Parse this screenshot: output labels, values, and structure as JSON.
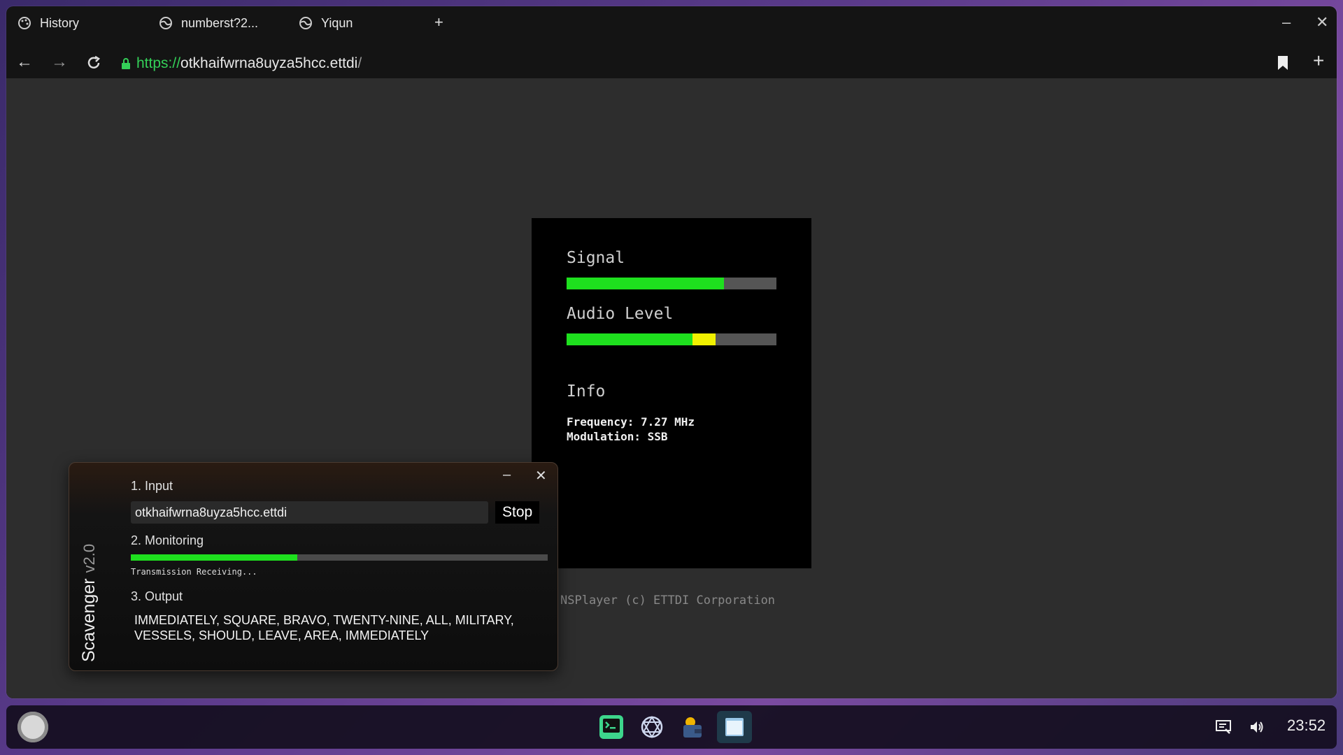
{
  "tabs": [
    {
      "label": "History",
      "icon": "palette-icon"
    },
    {
      "label": "numberst?2...",
      "icon": "globe-icon"
    },
    {
      "label": "Yiqun",
      "icon": "globe-icon"
    }
  ],
  "tab_add": "+",
  "window_controls": {
    "minimize": "–",
    "close": "✕"
  },
  "address": {
    "scheme": "https://",
    "host": "otkhaifwrna8uyza5hcc.ettdi",
    "path": "/"
  },
  "player": {
    "signal_label": "Signal",
    "signal_level": 0.75,
    "audio_label": "Audio Level",
    "audio_green_level": 0.6,
    "audio_yellow_level": 0.71,
    "info_label": "Info",
    "frequency": "Frequency: 7.27 MHz",
    "modulation": "Modulation: SSB",
    "colors": {
      "green": "#1ee01e",
      "yellow": "#f0f000"
    }
  },
  "footer": "NSPlayer (c) ETTDI Corporation",
  "scavenger": {
    "title": "Scavenger",
    "version": "v2.0",
    "input_label": "1. Input",
    "input_value": "otkhaifwrna8uyza5hcc.ettdi",
    "stop_label": "Stop",
    "monitoring_label": "2. Monitoring",
    "monitoring_progress": 0.4,
    "monitoring_status": "Transmission Receiving...",
    "output_label": "3. Output",
    "output_text": "IMMEDIATELY, SQUARE, BRAVO, TWENTY-NINE, ALL, MILITARY, VESSELS, SHOULD, LEAVE, AREA, IMMEDIATELY"
  },
  "taskbar": {
    "apps": [
      "terminal-icon",
      "network-icon",
      "wallet-icon",
      "window-icon"
    ],
    "tray": [
      "display-icon",
      "volume-icon"
    ],
    "clock": "23:52"
  }
}
